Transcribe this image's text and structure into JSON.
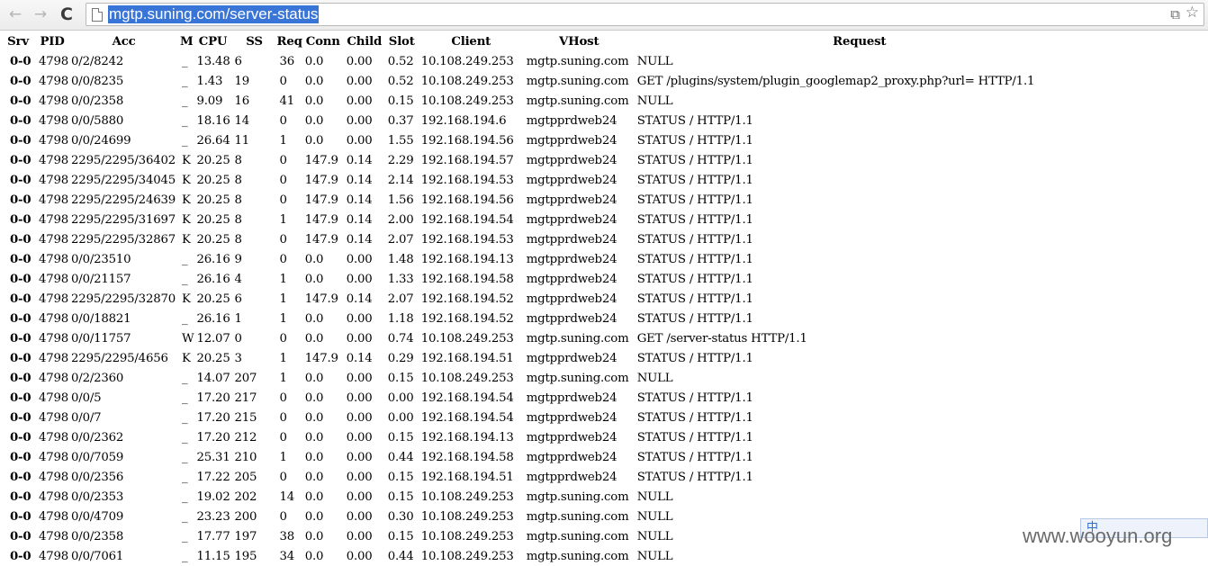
{
  "browser": {
    "url": "mgtp.suning.com/server-status",
    "back_icon": "←",
    "forward_icon": "→",
    "reload_icon": "C",
    "translate_icon": "⧉",
    "bookmark_icon": "☆"
  },
  "table": {
    "headers": [
      "Srv",
      "PID",
      "Acc",
      "M",
      "CPU",
      "SS",
      "Req",
      "Conn",
      "Child",
      "Slot",
      "Client",
      "VHost",
      "Request"
    ],
    "rows": [
      [
        "0-0",
        "4798",
        "0/2/8242",
        "_",
        "13.48",
        "6",
        "36",
        "0.0",
        "0.00",
        "0.52",
        "10.108.249.253",
        "mgtp.suning.com",
        "NULL"
      ],
      [
        "0-0",
        "4798",
        "0/0/8235",
        "_",
        "1.43",
        "19",
        "0",
        "0.0",
        "0.00",
        "0.52",
        "10.108.249.253",
        "mgtp.suning.com",
        "GET /plugins/system/plugin_googlemap2_proxy.php?url= HTTP/1.1"
      ],
      [
        "0-0",
        "4798",
        "0/0/2358",
        "_",
        "9.09",
        "16",
        "41",
        "0.0",
        "0.00",
        "0.15",
        "10.108.249.253",
        "mgtp.suning.com",
        "NULL"
      ],
      [
        "0-0",
        "4798",
        "0/0/5880",
        "_",
        "18.16",
        "14",
        "0",
        "0.0",
        "0.00",
        "0.37",
        "192.168.194.6",
        "mgtpprdweb24",
        "STATUS / HTTP/1.1"
      ],
      [
        "0-0",
        "4798",
        "0/0/24699",
        "_",
        "26.64",
        "11",
        "1",
        "0.0",
        "0.00",
        "1.55",
        "192.168.194.56",
        "mgtpprdweb24",
        "STATUS / HTTP/1.1"
      ],
      [
        "0-0",
        "4798",
        "2295/2295/36402",
        "K",
        "20.25",
        "8",
        "0",
        "147.9",
        "0.14",
        "2.29",
        "192.168.194.57",
        "mgtpprdweb24",
        "STATUS / HTTP/1.1"
      ],
      [
        "0-0",
        "4798",
        "2295/2295/34045",
        "K",
        "20.25",
        "8",
        "0",
        "147.9",
        "0.14",
        "2.14",
        "192.168.194.53",
        "mgtpprdweb24",
        "STATUS / HTTP/1.1"
      ],
      [
        "0-0",
        "4798",
        "2295/2295/24639",
        "K",
        "20.25",
        "8",
        "0",
        "147.9",
        "0.14",
        "1.56",
        "192.168.194.56",
        "mgtpprdweb24",
        "STATUS / HTTP/1.1"
      ],
      [
        "0-0",
        "4798",
        "2295/2295/31697",
        "K",
        "20.25",
        "8",
        "1",
        "147.9",
        "0.14",
        "2.00",
        "192.168.194.54",
        "mgtpprdweb24",
        "STATUS / HTTP/1.1"
      ],
      [
        "0-0",
        "4798",
        "2295/2295/32867",
        "K",
        "20.25",
        "8",
        "0",
        "147.9",
        "0.14",
        "2.07",
        "192.168.194.53",
        "mgtpprdweb24",
        "STATUS / HTTP/1.1"
      ],
      [
        "0-0",
        "4798",
        "0/0/23510",
        "_",
        "26.16",
        "9",
        "0",
        "0.0",
        "0.00",
        "1.48",
        "192.168.194.13",
        "mgtpprdweb24",
        "STATUS / HTTP/1.1"
      ],
      [
        "0-0",
        "4798",
        "0/0/21157",
        "_",
        "26.16",
        "4",
        "1",
        "0.0",
        "0.00",
        "1.33",
        "192.168.194.58",
        "mgtpprdweb24",
        "STATUS / HTTP/1.1"
      ],
      [
        "0-0",
        "4798",
        "2295/2295/32870",
        "K",
        "20.25",
        "6",
        "1",
        "147.9",
        "0.14",
        "2.07",
        "192.168.194.52",
        "mgtpprdweb24",
        "STATUS / HTTP/1.1"
      ],
      [
        "0-0",
        "4798",
        "0/0/18821",
        "_",
        "26.16",
        "1",
        "1",
        "0.0",
        "0.00",
        "1.18",
        "192.168.194.52",
        "mgtpprdweb24",
        "STATUS / HTTP/1.1"
      ],
      [
        "0-0",
        "4798",
        "0/0/11757",
        "W",
        "12.07",
        "0",
        "0",
        "0.0",
        "0.00",
        "0.74",
        "10.108.249.253",
        "mgtp.suning.com",
        "GET /server-status HTTP/1.1"
      ],
      [
        "0-0",
        "4798",
        "2295/2295/4656",
        "K",
        "20.25",
        "3",
        "1",
        "147.9",
        "0.14",
        "0.29",
        "192.168.194.51",
        "mgtpprdweb24",
        "STATUS / HTTP/1.1"
      ],
      [
        "0-0",
        "4798",
        "0/2/2360",
        "_",
        "14.07",
        "207",
        "1",
        "0.0",
        "0.00",
        "0.15",
        "10.108.249.253",
        "mgtp.suning.com",
        "NULL"
      ],
      [
        "0-0",
        "4798",
        "0/0/5",
        "_",
        "17.20",
        "217",
        "0",
        "0.0",
        "0.00",
        "0.00",
        "192.168.194.54",
        "mgtpprdweb24",
        "STATUS / HTTP/1.1"
      ],
      [
        "0-0",
        "4798",
        "0/0/7",
        "_",
        "17.20",
        "215",
        "0",
        "0.0",
        "0.00",
        "0.00",
        "192.168.194.54",
        "mgtpprdweb24",
        "STATUS / HTTP/1.1"
      ],
      [
        "0-0",
        "4798",
        "0/0/2362",
        "_",
        "17.20",
        "212",
        "0",
        "0.0",
        "0.00",
        "0.15",
        "192.168.194.13",
        "mgtpprdweb24",
        "STATUS / HTTP/1.1"
      ],
      [
        "0-0",
        "4798",
        "0/0/7059",
        "_",
        "25.31",
        "210",
        "1",
        "0.0",
        "0.00",
        "0.44",
        "192.168.194.58",
        "mgtpprdweb24",
        "STATUS / HTTP/1.1"
      ],
      [
        "0-0",
        "4798",
        "0/0/2356",
        "_",
        "17.22",
        "205",
        "0",
        "0.0",
        "0.00",
        "0.15",
        "192.168.194.51",
        "mgtpprdweb24",
        "STATUS / HTTP/1.1"
      ],
      [
        "0-0",
        "4798",
        "0/0/2353",
        "_",
        "19.02",
        "202",
        "14",
        "0.0",
        "0.00",
        "0.15",
        "10.108.249.253",
        "mgtp.suning.com",
        "NULL"
      ],
      [
        "0-0",
        "4798",
        "0/0/4709",
        "_",
        "23.23",
        "200",
        "0",
        "0.0",
        "0.00",
        "0.30",
        "10.108.249.253",
        "mgtp.suning.com",
        "NULL"
      ],
      [
        "0-0",
        "4798",
        "0/0/2358",
        "_",
        "17.77",
        "197",
        "38",
        "0.0",
        "0.00",
        "0.15",
        "10.108.249.253",
        "mgtp.suning.com",
        "NULL"
      ],
      [
        "0-0",
        "4798",
        "0/0/7061",
        "_",
        "11.15",
        "195",
        "34",
        "0.0",
        "0.00",
        "0.44",
        "10.108.249.253",
        "mgtp.suning.com",
        "NULL"
      ]
    ]
  },
  "ime_toolbar": {
    "label": "中"
  },
  "watermark": {
    "text": "www.wooyun.org"
  }
}
